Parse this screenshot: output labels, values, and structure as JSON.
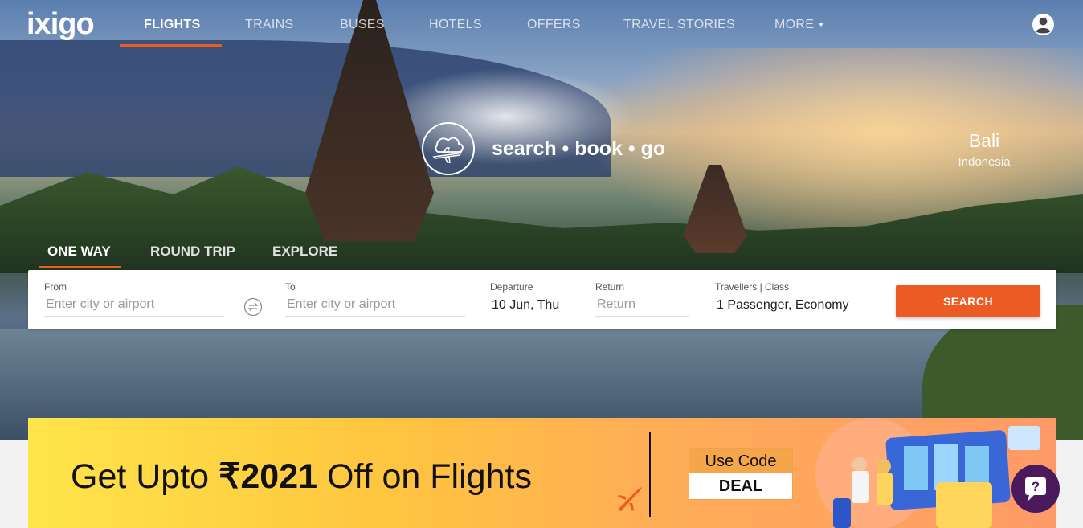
{
  "logo": {
    "text": "ixigo"
  },
  "nav": {
    "items": [
      {
        "label": "FLIGHTS",
        "active": true
      },
      {
        "label": "TRAINS"
      },
      {
        "label": "BUSES"
      },
      {
        "label": "HOTELS"
      },
      {
        "label": "OFFERS"
      },
      {
        "label": "TRAVEL STORIES"
      },
      {
        "label": "MORE"
      }
    ],
    "user_icon": "user-circle-icon"
  },
  "hero": {
    "tagline": "search • book • go",
    "destination": {
      "city": "Bali",
      "country": "Indonesia"
    }
  },
  "trip_types": [
    {
      "label": "ONE WAY",
      "active": true
    },
    {
      "label": "ROUND TRIP"
    },
    {
      "label": "EXPLORE"
    }
  ],
  "search": {
    "from": {
      "label": "From",
      "placeholder": "Enter city or airport"
    },
    "to": {
      "label": "To",
      "placeholder": "Enter city or airport"
    },
    "departure": {
      "label": "Departure",
      "value": "10 Jun, Thu"
    },
    "return": {
      "label": "Return",
      "placeholder": "Return"
    },
    "travellers": {
      "label": "Travellers | Class",
      "value": "1 Passenger, Economy"
    },
    "button_label": "SEARCH"
  },
  "banner": {
    "title_prefix": "Get Upto ",
    "amount": "₹2021",
    "title_suffix": " Off on Flights",
    "code_label": "Use Code",
    "code": "DEAL"
  },
  "colors": {
    "accent": "#ec5b24",
    "chat": "#4b1a5c"
  }
}
